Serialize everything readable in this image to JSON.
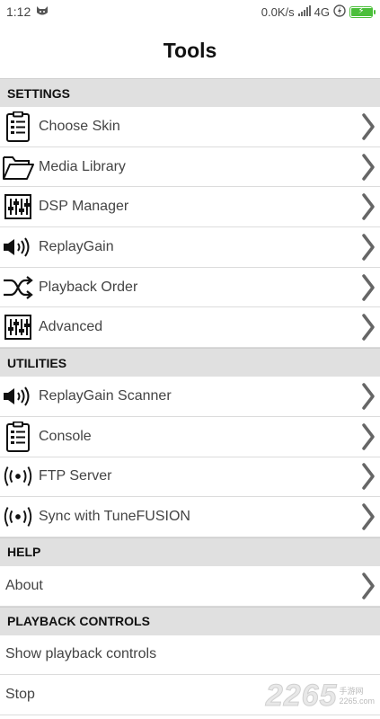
{
  "status": {
    "time": "1:12",
    "speed": "0.0K/s",
    "network": "4G",
    "icons": [
      "cat-icon",
      "signal-icon",
      "network-4g-icon",
      "data-icon",
      "battery-icon"
    ]
  },
  "title": "Tools",
  "sections": [
    {
      "header": "SETTINGS",
      "items": [
        {
          "label": "Choose Skin",
          "icon": "clipboard-list-icon",
          "chevron": true
        },
        {
          "label": "Media Library",
          "icon": "folder-open-icon",
          "chevron": true
        },
        {
          "label": "DSP Manager",
          "icon": "equalizer-icon",
          "chevron": true
        },
        {
          "label": "ReplayGain",
          "icon": "speaker-icon",
          "chevron": true
        },
        {
          "label": "Playback Order",
          "icon": "shuffle-icon",
          "chevron": true
        },
        {
          "label": "Advanced",
          "icon": "equalizer-icon",
          "chevron": true
        }
      ]
    },
    {
      "header": "UTILITIES",
      "items": [
        {
          "label": "ReplayGain Scanner",
          "icon": "speaker-icon",
          "chevron": true
        },
        {
          "label": "Console",
          "icon": "clipboard-list-icon",
          "chevron": true
        },
        {
          "label": "FTP Server",
          "icon": "broadcast-icon",
          "chevron": true
        },
        {
          "label": "Sync with TuneFUSION",
          "icon": "broadcast-icon",
          "chevron": true
        }
      ]
    },
    {
      "header": "HELP",
      "items": [
        {
          "label": "About",
          "icon": "",
          "chevron": true
        }
      ]
    },
    {
      "header": "PLAYBACK CONTROLS",
      "items": [
        {
          "label": "Show playback controls",
          "icon": "",
          "chevron": false
        },
        {
          "label": "Stop",
          "icon": "",
          "chevron": false
        }
      ]
    }
  ],
  "watermark": {
    "number": "2265",
    "line1": "手游网",
    "line2": "2265.com"
  },
  "colors": {
    "section_bg": "#e0e0e0",
    "battery": "#4bbf3a"
  }
}
